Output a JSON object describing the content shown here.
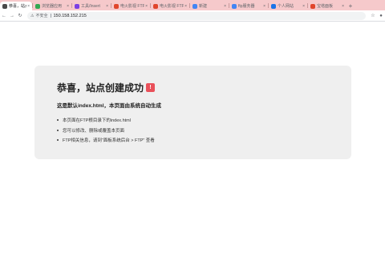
{
  "browser": {
    "tabs": [
      {
        "label": "恭喜，站点",
        "favicon_color": "#4a4a4a",
        "active": true
      },
      {
        "label": "浏览器应用",
        "favicon_color": "#34a853",
        "active": false
      },
      {
        "label": "工具/Insert",
        "favicon_color": "#7b3fe4",
        "active": false
      },
      {
        "label": "电火影视 FTP",
        "favicon_color": "#e0452c",
        "active": false
      },
      {
        "label": "电火影视 FTP",
        "favicon_color": "#e0452c",
        "active": false
      },
      {
        "label": "新建",
        "favicon_color": "#4285f4",
        "active": false
      },
      {
        "label": "ftp服务器",
        "favicon_color": "#4285f4",
        "active": false
      },
      {
        "label": "个人网站",
        "favicon_color": "#1a73e8",
        "active": false
      },
      {
        "label": "宝塔面板",
        "favicon_color": "#e0452c",
        "active": false
      }
    ],
    "new_tab": "+",
    "window_controls": {
      "minimize": "—",
      "maximize": "□",
      "close": "✕"
    },
    "address_bar": {
      "security_label": "不安全",
      "url": "150.158.152.215"
    },
    "icons": {
      "back": "←",
      "forward": "→",
      "reload": "↻",
      "warn": "⚠",
      "star": "☆",
      "profile": "●"
    }
  },
  "page": {
    "title": "恭喜，站点创建成功",
    "badge_text": "!",
    "subtitle": "这是默认index.html，本页面由系统自动生成",
    "items": [
      "本页面在FTP根目录下的index.html",
      "您可以修改、删除或覆盖本页面",
      "FTP相关信息，请到“面板系统后台 > FTP” 查看"
    ],
    "colors": {
      "card_bg": "#efefef",
      "badge": "#e9505a",
      "tabstrip": "#f6c9cb"
    }
  }
}
